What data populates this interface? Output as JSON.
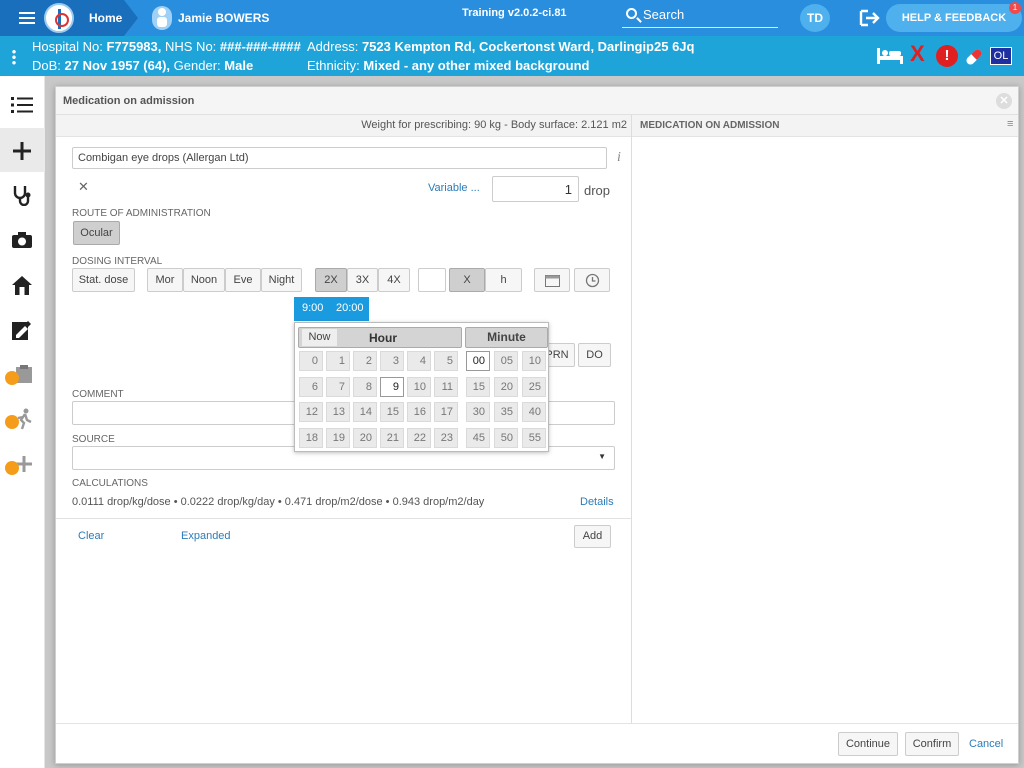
{
  "topbar": {
    "home": "Home",
    "patient_name": "Jamie BOWERS",
    "version": "Training v2.0.2-ci.81",
    "search": "Search",
    "user_initials": "TD",
    "help": "HELP & FEEDBACK",
    "help_badge": "1"
  },
  "patient": {
    "hospital_label": "Hospital No:",
    "hospital_no": "F775983,",
    "nhs_label": "NHS No:",
    "nhs_no": "###-###-####",
    "dob_label": "DoB:",
    "dob": "27 Nov 1957 (64),",
    "gender_label": "Gender:",
    "gender": "Male",
    "address_label": "Address:",
    "address": "7523 Kempton Rd, Cockertonst Ward, Darlingip25 6Jq",
    "ethnicity_label": "Ethnicity:",
    "ethnicity": "Mixed - any other mixed background",
    "flag_x": "X",
    "flag_alert": "!",
    "flag_ol": "OL"
  },
  "modal": {
    "title": "Medication on admission",
    "weight_info": "Weight for prescribing: 90 kg - Body surface: 2.121 m2",
    "right_panel_title": "MEDICATION ON ADMISSION",
    "drug": "Combigan eye drops (Allergan Ltd)",
    "info_icon_glyph": "i",
    "variable_link": "Variable ...",
    "dose_value": "1",
    "dose_unit": "drop",
    "route_label": "ROUTE OF ADMINISTRATION",
    "route_button": "Ocular",
    "dosing_label": "DOSING INTERVAL",
    "stat_dose": "Stat. dose",
    "times_of_day": [
      "Mor",
      "Noon",
      "Eve",
      "Night"
    ],
    "frequency": [
      "2X",
      "3X",
      "4X"
    ],
    "x_button": "X",
    "h_button": "h",
    "time_tags": [
      "9:00",
      "20:00"
    ],
    "prn_button": "PRN",
    "do_button": "DO",
    "comment_label": "COMMENT",
    "source_label": "SOURCE",
    "calculations_label": "CALCULATIONS",
    "calculations": "0.0111 drop/kg/dose • 0.0222 drop/kg/day • 0.471 drop/m2/dose • 0.943 drop/m2/day",
    "details_link": "Details",
    "clear_link": "Clear",
    "expanded_link": "Expanded",
    "add_button": "Add",
    "continue_button": "Continue",
    "confirm_button": "Confirm",
    "cancel_link": "Cancel"
  },
  "time_picker": {
    "now": "Now",
    "hour_header": "Hour",
    "minute_header": "Minute",
    "hours": [
      [
        "0",
        "1",
        "2",
        "3",
        "4",
        "5"
      ],
      [
        "6",
        "7",
        "8",
        "9",
        "10",
        "11"
      ],
      [
        "12",
        "13",
        "14",
        "15",
        "16",
        "17"
      ],
      [
        "18",
        "19",
        "20",
        "21",
        "22",
        "23"
      ]
    ],
    "minutes": [
      [
        "00",
        "05",
        "10"
      ],
      [
        "15",
        "20",
        "25"
      ],
      [
        "30",
        "35",
        "40"
      ],
      [
        "45",
        "50",
        "55"
      ]
    ],
    "selected_hour": "9",
    "selected_minute": "00"
  },
  "colors": {
    "topbar": "#2a8ede",
    "patient_bar": "#1fa4da",
    "accent": "#1a9be0",
    "alert_red": "#e02020"
  }
}
